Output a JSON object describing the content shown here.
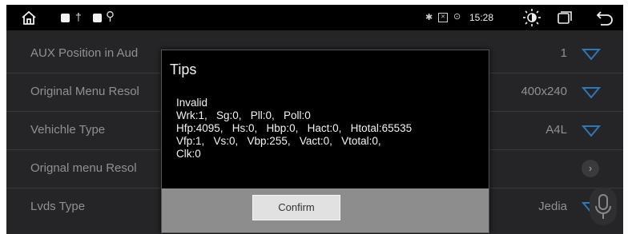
{
  "status_bar": {
    "time": "15:28"
  },
  "settings": {
    "rows": [
      {
        "label": "AUX Position in Aud",
        "value": "1"
      },
      {
        "label": "Original Menu Resol",
        "value": "400x240"
      },
      {
        "label": "Vehichle Type",
        "value": "A4L"
      },
      {
        "label": "Orignal menu Resol",
        "value": ""
      },
      {
        "label": "Lvds Type",
        "value": "Jedia"
      }
    ]
  },
  "dialog": {
    "title": "Tips",
    "lines": [
      "Invalid",
      "Wrk:1,   Sg:0,   Pll:0,   Poll:0",
      "Hfp:4095,   Hs:0,   Hbp:0,   Hact:0,   Htotal:65535",
      "Vfp:1,   Vs:0,   Vbp:255,   Vact:0,   Vtotal:0,",
      "Clk:0"
    ],
    "confirm_label": "Confirm"
  },
  "colors": {
    "background": "#252528",
    "status_bar": "#000000",
    "dropdown_accent": "#2f78b8",
    "dialog_footer": "#8d8d8d"
  }
}
